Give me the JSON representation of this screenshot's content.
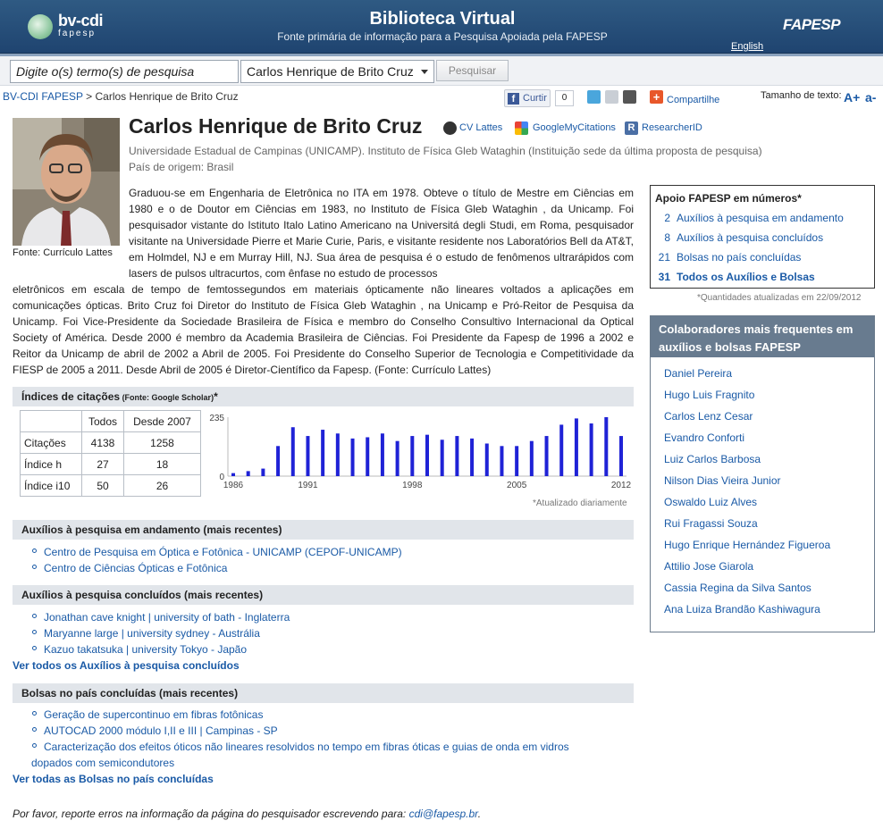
{
  "header": {
    "logo_text": "bv-cdi",
    "logo_sub": "fapesp",
    "title": "Biblioteca Virtual",
    "subtitle": "Fonte primária de informação para a Pesquisa Apoiada pela FAPESP",
    "fapesp_logo": "FAPESP",
    "english_link": "English"
  },
  "search": {
    "input_value": "Digite o(s) termo(s) de pesquisa",
    "select_value": "Carlos Henrique de Brito Cruz",
    "button_label": "Pesquisar"
  },
  "breadcrumb": {
    "root": "BV-CDI FAPESP",
    "separator": " > ",
    "current": "Carlos Henrique de Brito Cruz"
  },
  "share": {
    "curtir_label": "Curtir",
    "like_count": "0",
    "compartilhe_label": "Compartilhe",
    "text_size_label": "Tamanho de texto:",
    "a_plus": "A+",
    "a_minus": "a-"
  },
  "profile": {
    "name": "Carlos Henrique de Brito Cruz",
    "cv_lattes": "CV Lattes",
    "google_citations": "GoogleMyCitations",
    "researcher_id": "ResearcherID",
    "institution": "Universidade Estadual de Campinas (UNICAMP). Instituto de Física Gleb Wataghin (Instituição sede da última proposta de pesquisa)",
    "country": "País de origem: Brasil",
    "photo_caption": "Fonte: Currículo Lattes",
    "bio_top": "Graduou-se em Engenharia de Eletrônica no ITA em 1978. Obteve o título de Mestre em Ciências em 1980 e o de Doutor em Ciências em 1983, no Instituto de Física Gleb Wataghin , da Unicamp. Foi pesquisador vistante do Istituto Italo Latino Americano na Universitá degli Studi, em Roma, pesquisador visitante na Universidade Pierre et Marie Curie, Paris, e visitante residente nos Laboratórios Bell da AT&T, em Holmdel, NJ e em Murray Hill, NJ. Sua área de pesquisa é o estudo de fenômenos ultrarápidos com lasers de pulsos ultracurtos, com ênfase no estudo de processos",
    "bio_bottom": "eletrônicos em escala de tempo de femtossegundos em materiais ópticamente não lineares voltados a aplicações em comunicações ópticas. Brito Cruz foi Diretor do Instituto de Física Gleb Wataghin , na Unicamp e Pró-Reitor de Pesquisa da Unicamp. Foi Vice-Presidente da Sociedade Brasileira de Física e membro do Conselho Consultivo Internacional da Optical Society of América. Desde 2000 é membro da Academia Brasileira de Ciências. Foi Presidente da Fapesp de 1996 a 2002 e Reitor da Unicamp de abril de 2002 a Abril de 2005. Foi Presidente do Conselho Superior de Tecnologia e Competitividade da FIESP de 2005 a 2011. Desde Abril de 2005 é Diretor-Científico da Fapesp. (Fonte: Currículo Lattes)"
  },
  "stats": {
    "title": "Apoio FAPESP em números*",
    "rows": [
      {
        "num": "2",
        "label": "Auxílios à pesquisa em andamento",
        "bold": false
      },
      {
        "num": "8",
        "label": "Auxílios à pesquisa concluídos",
        "bold": false
      },
      {
        "num": "21",
        "label": "Bolsas no país concluídas",
        "bold": false
      },
      {
        "num": "31",
        "label": "Todos os Auxílios e Bolsas",
        "bold": true
      }
    ],
    "note": "*Quantidades atualizadas em 22/09/2012"
  },
  "collaborators": {
    "title": "Colaboradores mais frequentes em auxílios e bolsas FAPESP",
    "items": [
      "Daniel Pereira",
      "Hugo Luis Fragnito",
      "Carlos Lenz Cesar",
      "Evandro Conforti",
      "Luiz Carlos Barbosa",
      "Nilson Dias Vieira Junior",
      "Oswaldo Luiz Alves",
      "Rui Fragassi Souza",
      "Hugo Enrique Hernández Figueroa",
      "Attilio Jose Giarola",
      "Cassia Regina da Silva Santos",
      "Ana Luiza Brandão Kashiwagura"
    ]
  },
  "citations": {
    "heading": "Índices de citações",
    "heading_source": " (Fonte: Google Scholar)",
    "heading_star": "*",
    "col_todos": "Todos",
    "col_desde": "Desde 2007",
    "rows": [
      {
        "label": "Citações",
        "todos": "4138",
        "desde": "1258"
      },
      {
        "label": "Índice h",
        "todos": "27",
        "desde": "18"
      },
      {
        "label": "Índice i10",
        "todos": "50",
        "desde": "26"
      }
    ],
    "updated": "*Atualizado diariamente"
  },
  "chart_data": {
    "type": "bar",
    "color": "#1f22d6",
    "x": [
      1986,
      1987,
      1988,
      1989,
      1990,
      1991,
      1992,
      1993,
      1994,
      1995,
      1996,
      1997,
      1998,
      1999,
      2000,
      2001,
      2002,
      2003,
      2004,
      2005,
      2006,
      2007,
      2008,
      2009,
      2010,
      2011,
      2012
    ],
    "values": [
      12,
      20,
      30,
      120,
      195,
      160,
      185,
      170,
      150,
      155,
      170,
      140,
      160,
      165,
      145,
      160,
      150,
      130,
      120,
      120,
      140,
      160,
      205,
      230,
      210,
      235,
      160
    ],
    "ylim": [
      0,
      235
    ],
    "y_ticks": [
      "235",
      "0"
    ],
    "x_tick_labels": [
      "1986",
      "1991",
      "1998",
      "2005",
      "2012"
    ],
    "x_tick_years": [
      1986,
      1991,
      1998,
      2005,
      2012
    ]
  },
  "andamento": {
    "heading": "Auxílios à pesquisa em andamento (mais recentes)",
    "items": [
      "Centro de Pesquisa em Óptica e Fotônica - UNICAMP (CEPOF-UNICAMP)",
      "Centro de Ciências Ópticas e Fotônica"
    ]
  },
  "concluidos": {
    "heading": "Auxílios à pesquisa concluídos (mais recentes)",
    "items": [
      "Jonathan cave knight | university of bath - Inglaterra",
      "Maryanne large | university sydney - Austrália",
      "Kazuo takatsuka | university Tokyo - Japão"
    ],
    "see_all": "Ver todos os Auxílios à pesquisa concluídos"
  },
  "bolsas": {
    "heading": "Bolsas no país concluídas (mais recentes)",
    "items": [
      "Geração de supercontinuo em fibras fotônicas",
      "AUTOCAD 2000 módulo I,II e III | Campinas - SP",
      "Caracterização dos efeitos óticos não lineares resolvidos no tempo em fibras óticas e guias de onda em vidros",
      "dopados com semicondutores"
    ],
    "see_all": "Ver todas as Bolsas no país concluídas"
  },
  "footer": {
    "text": "Por favor, reporte erros na informação da página do pesquisador escrevendo para: ",
    "email": "cdi@fapesp.br",
    "period": "."
  }
}
